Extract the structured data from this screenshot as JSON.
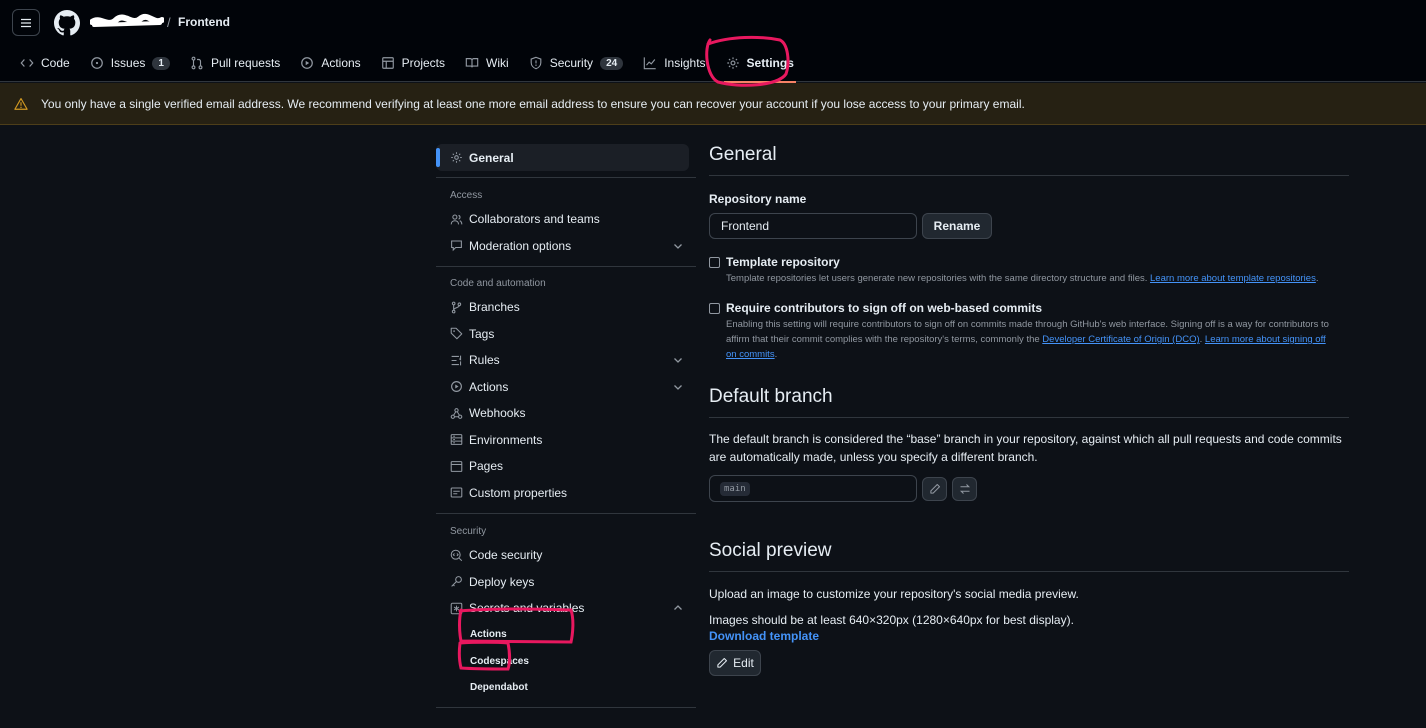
{
  "header": {
    "repo_name": "Frontend",
    "separator": "/"
  },
  "tabs": [
    {
      "label": "Code",
      "icon": "code-icon"
    },
    {
      "label": "Issues",
      "icon": "issue-icon",
      "count": "1"
    },
    {
      "label": "Pull requests",
      "icon": "pull-request-icon"
    },
    {
      "label": "Actions",
      "icon": "play-icon"
    },
    {
      "label": "Projects",
      "icon": "table-icon"
    },
    {
      "label": "Wiki",
      "icon": "book-icon"
    },
    {
      "label": "Security",
      "icon": "shield-icon",
      "count": "24"
    },
    {
      "label": "Insights",
      "icon": "graph-icon"
    },
    {
      "label": "Settings",
      "icon": "gear-icon",
      "selected": true
    }
  ],
  "banner": {
    "text": "You only have a single verified email address. We recommend verifying at least one more email address to ensure you can recover your account if you lose access to your primary email."
  },
  "sidebar": {
    "general": "General",
    "group_access": "Access",
    "collaborators": "Collaborators and teams",
    "moderation": "Moderation options",
    "group_code": "Code and automation",
    "branches": "Branches",
    "tags": "Tags",
    "rules": "Rules",
    "actions": "Actions",
    "webhooks": "Webhooks",
    "environments": "Environments",
    "pages": "Pages",
    "custom_properties": "Custom properties",
    "group_security": "Security",
    "code_security": "Code security",
    "deploy_keys": "Deploy keys",
    "secrets": "Secrets and variables",
    "sub_actions": "Actions",
    "sub_codespaces": "Codespaces",
    "sub_dependabot": "Dependabot"
  },
  "main": {
    "general_title": "General",
    "repo_name_label": "Repository name",
    "repo_name_value": "Frontend",
    "rename_button": "Rename",
    "template_title": "Template repository",
    "template_desc": "Template repositories let users generate new repositories with the same directory structure and files.",
    "template_link": "Learn more about template repositories",
    "signoff_title": "Require contributors to sign off on web-based commits",
    "signoff_desc": "Enabling this setting will require contributors to sign off on commits made through GitHub's web interface. Signing off is a way for contributors to affirm that their commit complies with the repository's terms, commonly the",
    "signoff_link1": "Developer Certificate of Origin (DCO)",
    "signoff_link2": "Learn more about signing off on commits",
    "default_branch_title": "Default branch",
    "default_branch_desc": "The default branch is considered the “base” branch in your repository, against which all pull requests and code commits are automatically made, unless you specify a different branch.",
    "branch_value": "main",
    "social_title": "Social preview",
    "social_desc1": "Upload an image to customize your repository's social media preview.",
    "social_desc2": "Images should be at least 640×320px (1280×640px for best display).",
    "download_template": "Download template",
    "edit_button": "Edit"
  },
  "colors": {
    "accent": "#4493f8",
    "annotation": "#e8185f",
    "tab_underline": "#f78166",
    "banner_bg": "#262113"
  }
}
